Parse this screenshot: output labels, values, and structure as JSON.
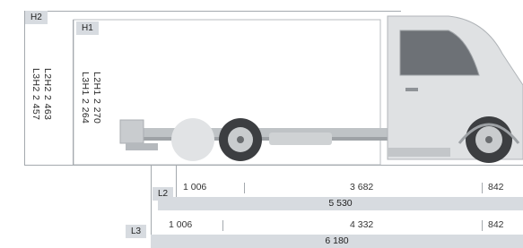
{
  "heights": {
    "h2": {
      "tag": "H2",
      "label_a": "L2H2 2 463",
      "label_b": "L3H2 2 457"
    },
    "h1": {
      "tag": "H1",
      "label_a": "L2H1 2 270",
      "label_b": "L3H1 2 264"
    }
  },
  "lengths": {
    "l2": {
      "tag": "L2",
      "front_overhang": "1 006",
      "wheelbase": "3 682",
      "rear_overhang": "842",
      "total": "5 530"
    },
    "l3": {
      "tag": "L3",
      "front_overhang": "1 006",
      "wheelbase": "4 332",
      "rear_overhang": "842",
      "total": "6 180"
    }
  },
  "colors": {
    "guide_line": "#a4a9ae",
    "label_band": "#d7dbe0"
  }
}
